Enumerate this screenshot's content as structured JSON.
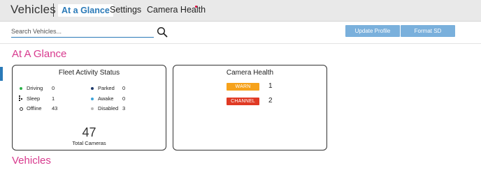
{
  "header": {
    "title": "Vehicles",
    "tabs": [
      {
        "label": "At a Glance",
        "active": true
      },
      {
        "label": "Settings",
        "active": false
      },
      {
        "label": "Camera Health",
        "active": false,
        "alert_dot": true
      }
    ]
  },
  "toolbar": {
    "search_placeholder": "Search Vehicles...",
    "search_value": "",
    "search_icon": "search-icon",
    "update_profile_label": "Update Profile",
    "format_sd_label": "Format SD"
  },
  "sections": {
    "glance_title": "At A Glance",
    "vehicles_title": "Vehicles"
  },
  "fleet": {
    "title": "Fleet Activity Status",
    "stats": [
      {
        "label": "Driving",
        "value": "0",
        "color": "#2bb34a"
      },
      {
        "label": "Sleep",
        "value": "1",
        "icon": "sleep-icon"
      },
      {
        "label": "Offline",
        "value": "43",
        "color": "#ffffff"
      },
      {
        "label": "Parked",
        "value": "0",
        "color": "#1f3a6b"
      },
      {
        "label": "Awake",
        "value": "0",
        "color": "#3aa3d9"
      },
      {
        "label": "Disabled",
        "value": "3",
        "color": "#b9b9b9"
      }
    ],
    "total": "47",
    "total_label": "Total Cameras"
  },
  "camera_health": {
    "title": "Camera Health",
    "rows": [
      {
        "badge": "WARN",
        "count": "1",
        "color": "#f6a21b"
      },
      {
        "badge": "CHANNEL",
        "count": "2",
        "color": "#e03a24"
      }
    ]
  },
  "colors": {
    "accent": "#2a7ab8",
    "section_title": "#d83a8e",
    "button_bg": "#7ab0dc",
    "alert": "#e0003c"
  }
}
